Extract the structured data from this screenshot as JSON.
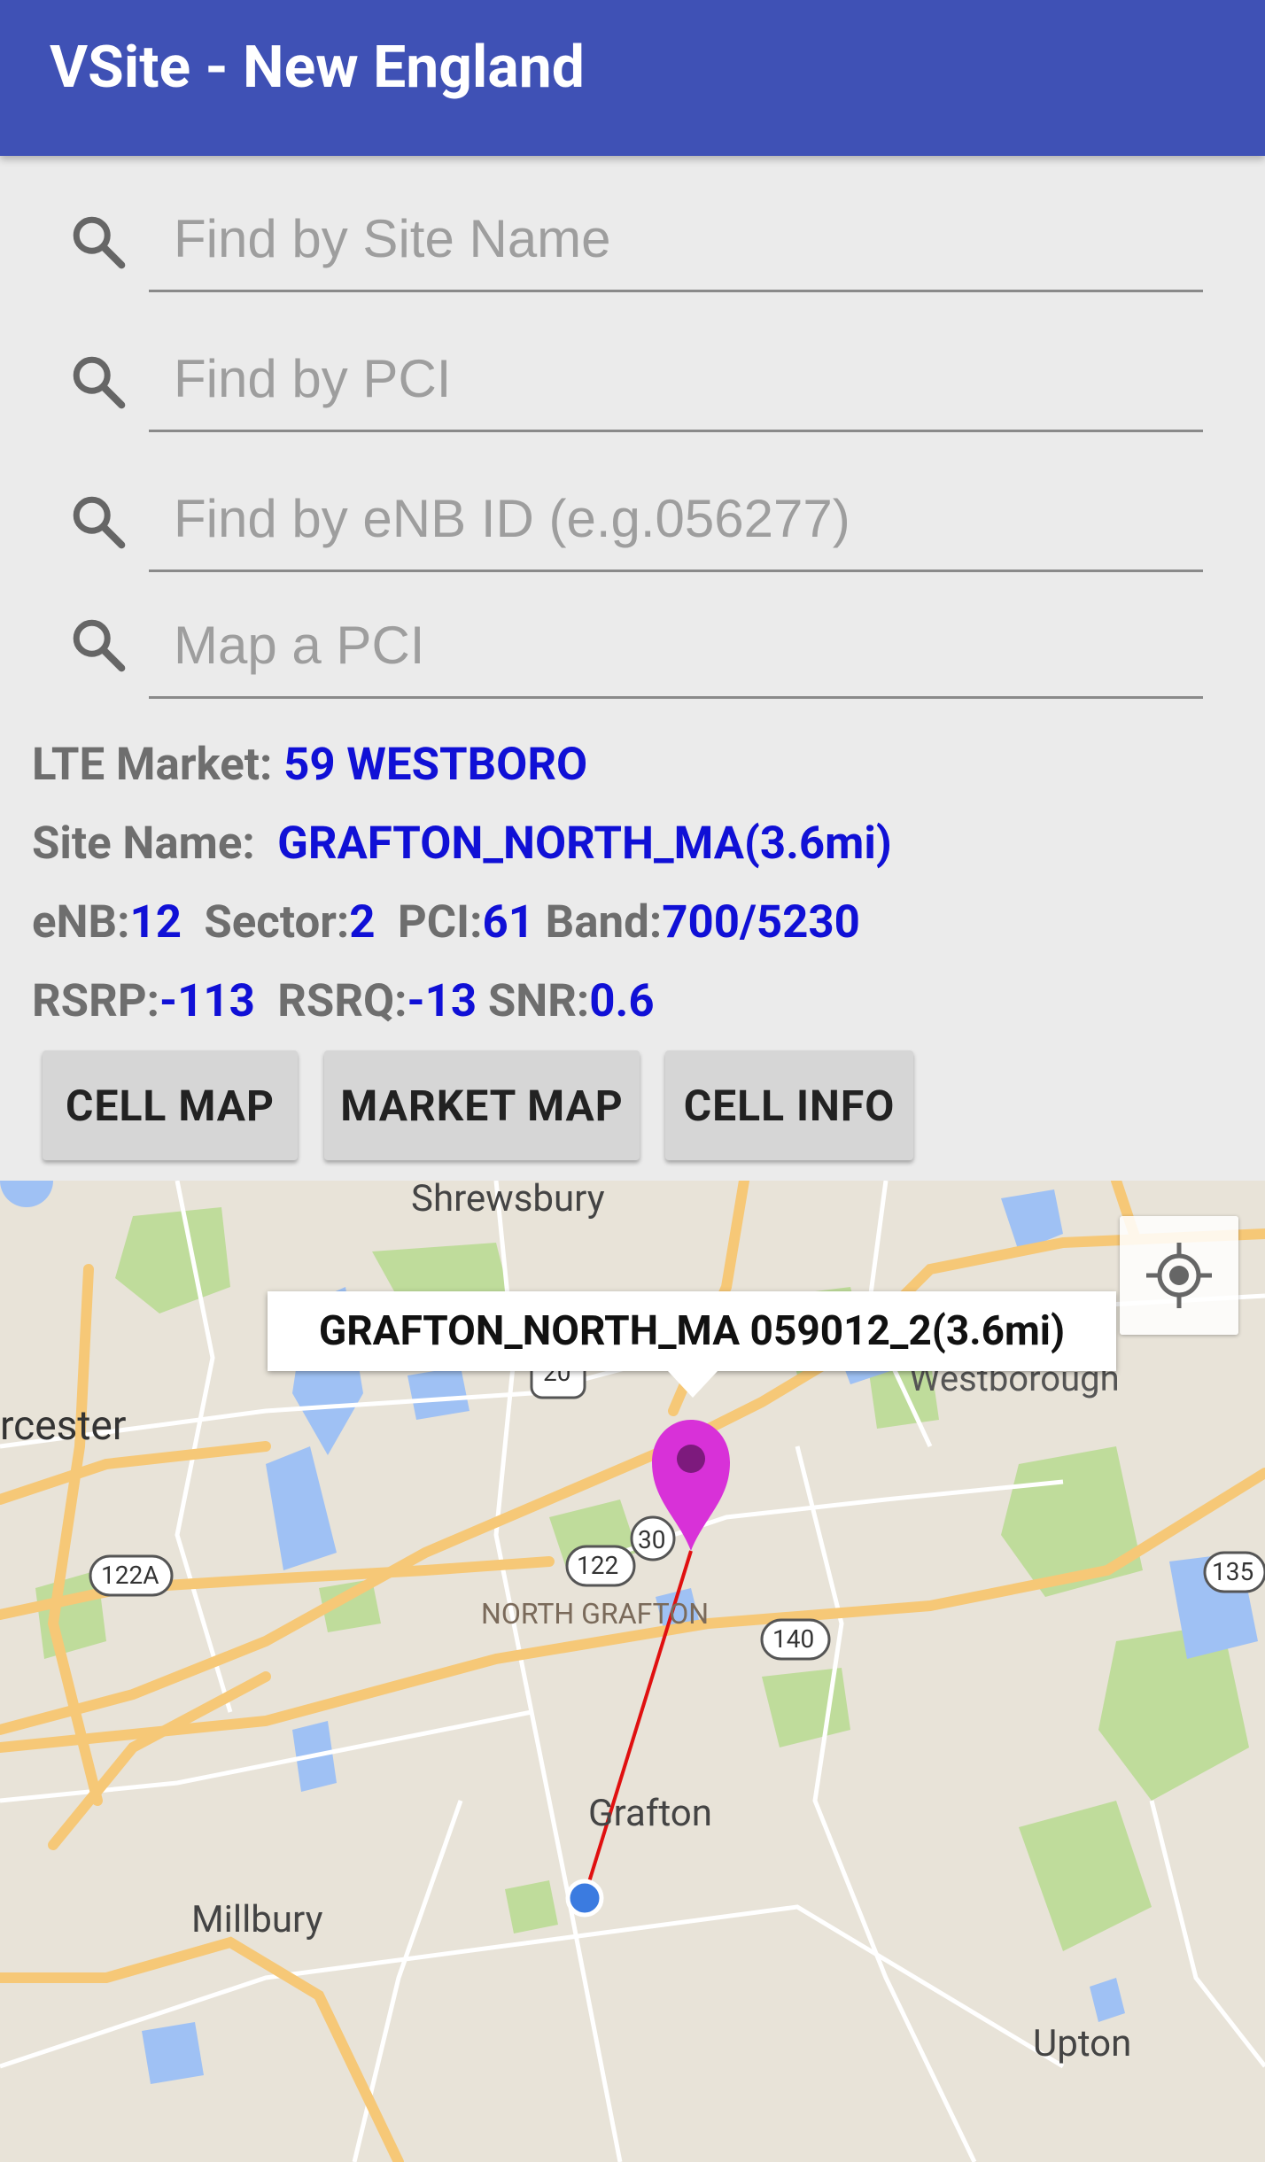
{
  "app": {
    "title": "VSite - New England"
  },
  "search": {
    "site_name_placeholder": "Find by Site Name",
    "pci_placeholder": "Find by PCI",
    "enb_placeholder": "Find by eNB ID (e.g.056277)",
    "map_pci_placeholder": "Map a PCI"
  },
  "info": {
    "market_label": "LTE Market:",
    "market_value": "59 WESTBORO",
    "site_label": "Site Name:",
    "site_value": "GRAFTON_NORTH_MA(3.6mi)",
    "enb_label": "eNB:",
    "enb_value": "12",
    "sector_label": "Sector:",
    "sector_value": "2",
    "pci_label": "PCI:",
    "pci_value": "61",
    "band_label": "Band:",
    "band_value": "700/5230",
    "rsrp_label": "RSRP:",
    "rsrp_value": "-113",
    "rsrq_label": "RSRQ:",
    "rsrq_value": "-13",
    "snr_label": "SNR:",
    "snr_value": "0.6"
  },
  "buttons": {
    "cell_map": "CELL MAP",
    "market_map": "MARKET MAP",
    "cell_info": "CELL INFO"
  },
  "map": {
    "popup": "GRAFTON_NORTH_MA 059012_2(3.6mi)",
    "places": {
      "shrewsbury": "Shrewsbury",
      "worcester": "rcester",
      "westborough": "Westborough",
      "north_grafton": "NORTH GRAFTON",
      "grafton": "Grafton",
      "millbury": "Millbury",
      "upton": "Upton"
    },
    "routes": {
      "r20": "20",
      "r30": "30",
      "r122": "122",
      "r122a": "122A",
      "r135": "135",
      "r140": "140"
    },
    "colors": {
      "pin": "#d831d8",
      "user_dot": "#3b7be0",
      "line": "#e01010",
      "water": "#9fc1f4",
      "park": "#bfdc9b",
      "highway": "#f6c877"
    }
  }
}
